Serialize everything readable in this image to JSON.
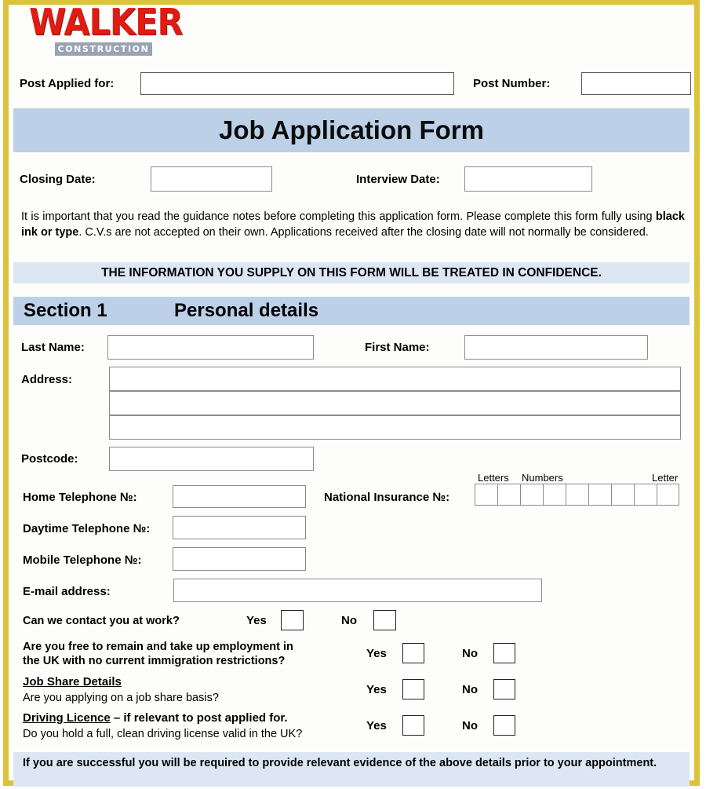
{
  "company": {
    "name": "WALKER",
    "subtitle": "CONSTRUCTION"
  },
  "header": {
    "post_applied_label": "Post Applied for:",
    "post_applied_value": "",
    "post_number_label": "Post Number:",
    "post_number_value": ""
  },
  "title_banner": {
    "text": "Job Application Form"
  },
  "dates": {
    "closing_label": "Closing Date:",
    "closing_value": "",
    "interview_label": "Interview Date:",
    "interview_value": ""
  },
  "intro": {
    "part1": "It is important that you read the guidance notes before completing this application form. Please complete this form fully using ",
    "emphasis": "black ink or type",
    "part2": ". C.V.s are not accepted on their own. Applications received after the closing date will not normally be considered."
  },
  "confidence_banner": {
    "text": "THE INFORMATION YOU SUPPLY ON THIS FORM WILL BE TREATED IN CONFIDENCE."
  },
  "section1": {
    "number": "Section 1",
    "title": "Personal details",
    "fields": {
      "last_name_label": "Last Name:",
      "last_name_value": "",
      "first_name_label": "First Name:",
      "first_name_value": "",
      "address_label": "Address:",
      "address_line1": "",
      "address_line2": "",
      "address_line3": "",
      "postcode_label": "Postcode:",
      "postcode_value": "",
      "home_tel_label": "Home Telephone №:",
      "home_tel_value": "",
      "daytime_tel_label": "Daytime Telephone №:",
      "daytime_tel_value": "",
      "mobile_tel_label": "Mobile Telephone №:",
      "mobile_tel_value": "",
      "email_label": "E-mail address:",
      "email_value": ""
    },
    "national_insurance": {
      "label": "National Insurance №:",
      "hint_letters": "Letters",
      "hint_numbers": "Numbers",
      "hint_letter": "Letter",
      "cells": [
        "",
        "",
        "",
        "",
        "",
        "",
        "",
        "",
        ""
      ]
    },
    "questions": [
      {
        "id": "contact-at-work",
        "text": "Can we contact you at work?",
        "yes_label": "Yes",
        "no_label": "No"
      },
      {
        "id": "immigration",
        "line1": "Are you free to remain and take up employment in",
        "line2": "the UK with no current immigration restrictions?",
        "yes_label": "Yes",
        "no_label": "No"
      },
      {
        "id": "job-share",
        "heading": "Job Share Details",
        "text": "Are you applying on a job share basis?",
        "yes_label": "Yes",
        "no_label": "No"
      },
      {
        "id": "driving-licence",
        "heading": "Driving Licence",
        "heading_suffix": " – if relevant to post applied for.",
        "text": "Do you hold a full, clean driving license valid in the UK?",
        "yes_label": "Yes",
        "no_label": "No"
      }
    ]
  },
  "footer_banner": {
    "text": "If you are successful you will be required to provide relevant evidence of the above details prior to your appointment."
  },
  "colors": {
    "border_gold": "#dcc33c",
    "banner_blue": "#bcd1e8",
    "banner_light_blue": "#dde7f4",
    "logo_red": "#e01b14",
    "logo_bar_gray": "#9aa3b4"
  }
}
